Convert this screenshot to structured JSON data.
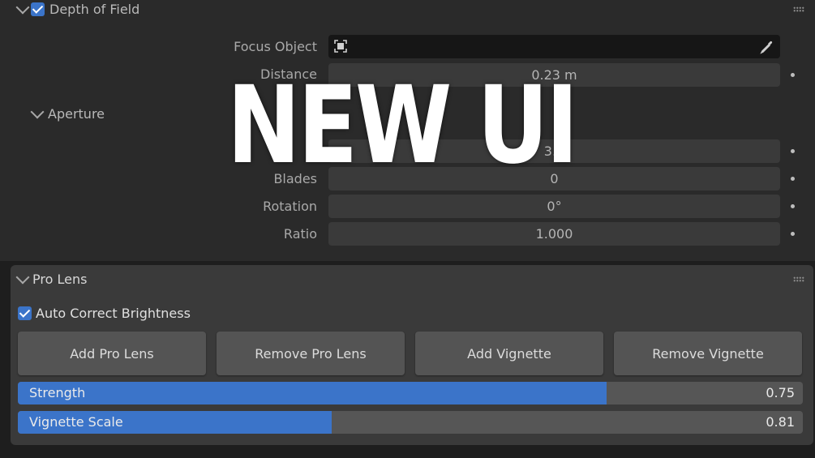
{
  "overlay": {
    "title": "NEW UI"
  },
  "dof": {
    "header": "Depth of Field",
    "enabled": true,
    "focus_object_label": "Focus Object",
    "distance_label": "Distance",
    "distance_value": "0.23 m"
  },
  "aperture": {
    "header": "Aperture",
    "fstop_value": "3.0",
    "blades_label": "Blades",
    "blades_value": "0",
    "rotation_label": "Rotation",
    "rotation_value": "0°",
    "ratio_label": "Ratio",
    "ratio_value": "1.000"
  },
  "pro_lens": {
    "header": "Pro Lens",
    "auto_correct_label": "Auto Correct Brightness",
    "auto_correct_enabled": true,
    "buttons": {
      "add_pro_lens": "Add Pro Lens",
      "remove_pro_lens": "Remove Pro Lens",
      "add_vignette": "Add Vignette",
      "remove_vignette": "Remove Vignette"
    },
    "strength": {
      "label": "Strength",
      "value": "0.75",
      "fraction": 0.75
    },
    "vignette_scale": {
      "label": "Vignette Scale",
      "value": "0.81",
      "fraction": 0.4
    }
  },
  "colors": {
    "accent": "#3b74c9",
    "panel": "#3a3a3a",
    "field": "#3a3a3a",
    "background": "#1e1e1e"
  },
  "icons": [
    "chevron-down-icon",
    "checkbox-icon",
    "drag-handle-icon",
    "object-icon",
    "eyedropper-icon",
    "animate-dot-icon"
  ]
}
